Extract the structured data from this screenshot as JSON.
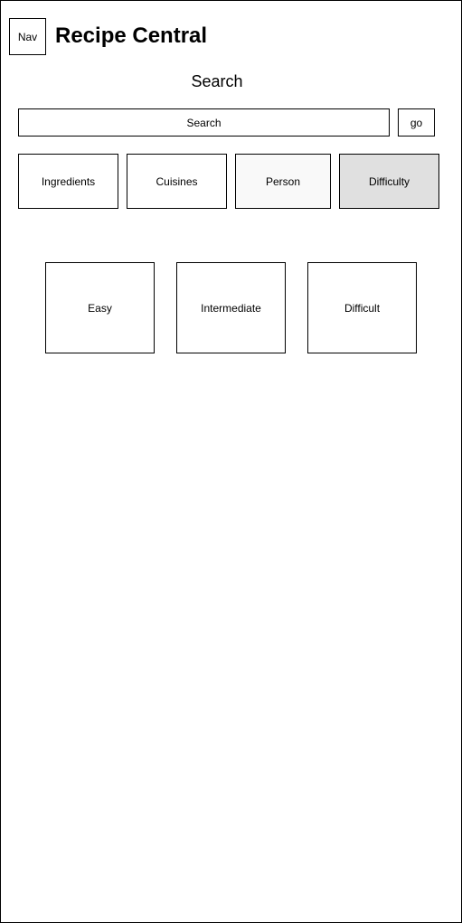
{
  "header": {
    "nav_label": "Nav",
    "title": "Recipe Central"
  },
  "search": {
    "heading": "Search",
    "placeholder": "Search",
    "go_label": "go"
  },
  "filters": {
    "tabs": [
      {
        "label": "Ingredients",
        "color": "#ffffff"
      },
      {
        "label": "Cuisines",
        "color": "#ffffff"
      },
      {
        "label": "Person",
        "color": "#f9f9f9"
      },
      {
        "label": "Difficulty",
        "color": "#e0e0e0",
        "selected": true
      }
    ]
  },
  "difficulty": {
    "options": [
      {
        "label": "Easy"
      },
      {
        "label": "Intermediate"
      },
      {
        "label": "Difficult"
      }
    ]
  }
}
